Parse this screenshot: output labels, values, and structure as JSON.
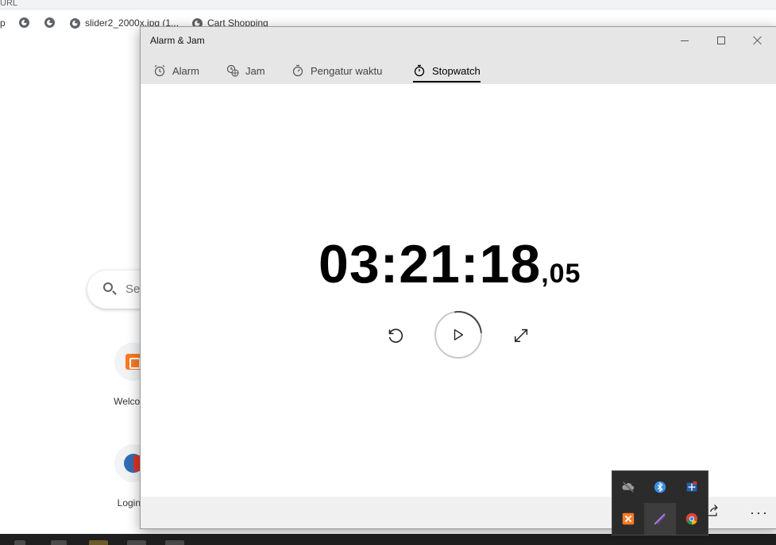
{
  "browser": {
    "url_fragment": "URL",
    "bookmarks": [
      {
        "label": "p"
      },
      {
        "label": ""
      },
      {
        "label": ""
      },
      {
        "label": "slider2_2000x.jpg (1..."
      },
      {
        "label": "Cart Shopping"
      }
    ],
    "search_placeholder": "Se",
    "shortcuts": [
      {
        "label": "Welcome"
      },
      {
        "label": "Login P"
      }
    ]
  },
  "window": {
    "title": "Alarm & Jam",
    "tabs": [
      {
        "label": "Alarm",
        "icon": "alarm-clock-icon",
        "active": false
      },
      {
        "label": "Jam",
        "icon": "world-clock-icon",
        "active": false
      },
      {
        "label": "Pengatur waktu",
        "icon": "timer-icon",
        "active": false
      },
      {
        "label": "Stopwatch",
        "icon": "stopwatch-icon",
        "active": true
      }
    ],
    "stopwatch": {
      "time": "03:21:18",
      "fraction": ",05"
    },
    "more_label": "···"
  },
  "tray": {
    "icons": [
      "onedrive-offline-icon",
      "bluetooth-icon",
      "network-app-icon",
      "xampp-icon",
      "pen-icon",
      "chrome-icon"
    ]
  },
  "colors": {
    "titlebar": "#e6e6e6",
    "tray_bg": "#2b2b2b",
    "xampp": "#fb7a24",
    "bluetooth": "#3a8ee6"
  }
}
